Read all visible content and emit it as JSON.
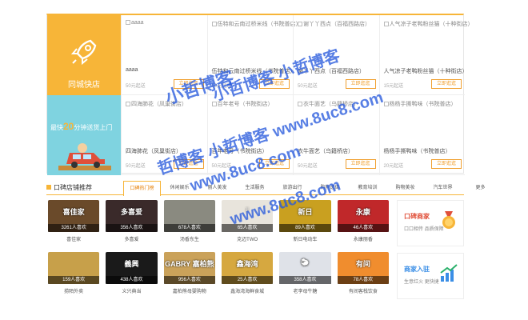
{
  "city_panel": {
    "title": "同城快店",
    "promo_prefix": "最快",
    "promo_number": "20",
    "promo_suffix": "分钟送货上门"
  },
  "shops": [
    {
      "img_alt": "aaaa",
      "name": "aaaa",
      "price": "50元起送",
      "button": "立即逛逛"
    },
    {
      "img_alt": "伍特和云南过桥米线（书院普店）",
      "name": "伍特和云南过桥米线（书院普店）",
      "price": "50元起送",
      "button": "立即逛逛"
    },
    {
      "img_alt": "谢丫丫西点（百福西路店）",
      "name": "谢丫丫西点（百福西路店）",
      "price": "50元起送",
      "button": "立即逛逛"
    },
    {
      "img_alt": "人气凉子老鸭粉丝猫（十种街店）",
      "name": "人气凉子老鸭粉丝猫（十种街店）",
      "price": "15元起送",
      "button": "立即逛逛"
    },
    {
      "img_alt": "四海肺花（凤巢街店）",
      "name": "四海肺花（凤巢街店）",
      "price": "50元起送",
      "button": "立即逛逛"
    },
    {
      "img_alt": "百年老号（书院街店）",
      "name": "百年老号（书院街店）",
      "price": "50元起送",
      "button": "立即逛逛"
    },
    {
      "img_alt": "衣牛面艺（乌籍桥店）",
      "name": "衣牛面艺（乌籍桥店）",
      "price": "50元起送",
      "button": "立即逛逛"
    },
    {
      "img_alt": "杨杨手撕鸭味（书院普店）",
      "name": "杨杨手撕鸭味（书院普店）",
      "price": "20元起送",
      "button": "立即逛逛"
    }
  ],
  "recommend": {
    "title": "口碑店铺推荐",
    "tabs": [
      "口碑热门榜",
      "休闲娱乐",
      "丽人美发",
      "生活服务",
      "旅游出行",
      "购物逛街",
      "教育培训",
      "购物美妆",
      "汽车世界",
      "更多"
    ],
    "active_tab": 0
  },
  "cards": [
    {
      "count": "3261人喜欢",
      "label": "喜佳家",
      "color": "#6a4a2a",
      "sign": "喜佳家"
    },
    {
      "count": "356人喜欢",
      "label": "多喜爱",
      "color": "#3a2a2a",
      "sign": "多喜爱"
    },
    {
      "count": "678人喜欢",
      "label": "汤香东生",
      "color": "#8a8a80",
      "sign": ""
    },
    {
      "count": "65人喜欢",
      "label": "克迈TWO",
      "color": "#e8e4dc",
      "sign": "✌"
    },
    {
      "count": "89人喜欢",
      "label": "新日电动车",
      "color": "#c9a020",
      "sign": "新日"
    },
    {
      "count": "46人喜欢",
      "label": "永康丽香",
      "color": "#c0282a",
      "sign": "永康"
    },
    {
      "count": "159人喜欢",
      "label": "捞陌外卖",
      "color": "#c7a04a",
      "sign": ""
    },
    {
      "count": "438人喜欢",
      "label": "义兴典当",
      "color": "#1a1a1a",
      "sign": "義興"
    },
    {
      "count": "956人喜欢",
      "label": "嘉柏熊母婴购物",
      "color": "#caa25a",
      "sign": "GABRY 嘉柏熊"
    },
    {
      "count": "25人喜欢",
      "label": "鑫海湾海鲜食城",
      "color": "#d6a840",
      "sign": "鑫海湾"
    },
    {
      "count": "358人喜欢",
      "label": "老李母牛糖",
      "color": "#dfe2e8",
      "sign": "🐑"
    },
    {
      "count": "78人喜欢",
      "label": "有间客栈饮食",
      "color": "#f08d2e",
      "sign": "有间"
    }
  ],
  "side": {
    "merchant_title": "口碑商家",
    "merchant_sub": "口口相传 品质保障",
    "join_title": "商家入驻",
    "join_sub": "生意红火 更快捷"
  },
  "watermark": {
    "line1": "小哲博客",
    "line2": "小哲博客 小哲博客",
    "line3": "哲博客 小哲博客 www.8uc8.com",
    "line4": "www.8uc8.com",
    "line5": "www.8uc8.com"
  }
}
